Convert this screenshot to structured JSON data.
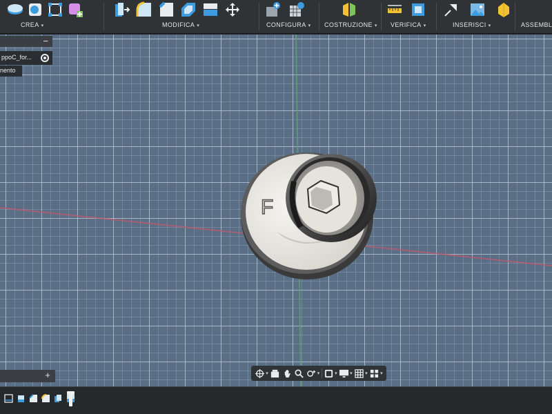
{
  "toolbar": {
    "groups": [
      {
        "label": "CREA",
        "caret": "▾"
      },
      {
        "label": "MODIFICA",
        "caret": "▾"
      },
      {
        "label": "CONFIGURA",
        "caret": "▾"
      },
      {
        "label": "COSTRUZIONE",
        "caret": "▾"
      },
      {
        "label": "VERIFICA",
        "caret": "▾"
      },
      {
        "label": "INSERISCI",
        "caret": "▾"
      },
      {
        "label": "ASSEMBL"
      }
    ]
  },
  "browser": {
    "collapse": "−",
    "component_name": "ppoC_for...",
    "row2_text": "nento"
  },
  "comments": {
    "add": "+"
  },
  "model": {
    "engraved_letter": "F"
  },
  "colors": {
    "accent_blue": "#3d9be0",
    "accent_yellow": "#f2c233",
    "accent_green": "#7cc35a",
    "accent_pink": "#d58fe6",
    "viewport_grid": "#5a6f86"
  }
}
